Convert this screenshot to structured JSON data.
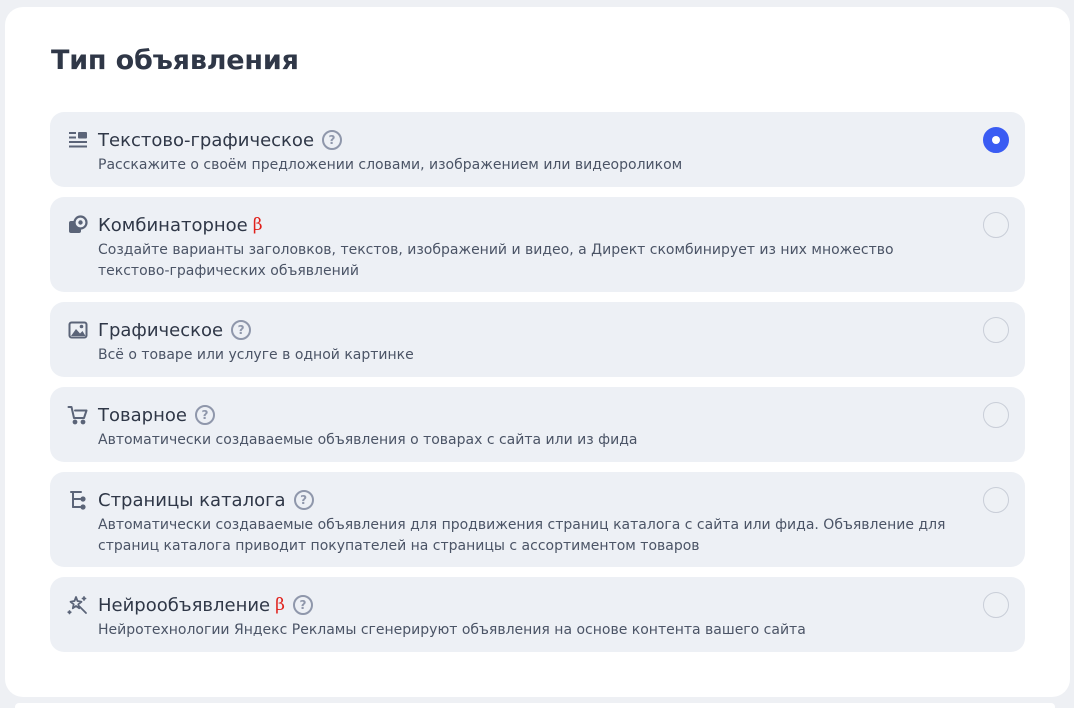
{
  "section": {
    "title": "Тип объявления"
  },
  "options": [
    {
      "id": "text-graphic",
      "name": "Текстово-графическое",
      "beta": "",
      "has_help": true,
      "description": "Расскажите о своём предложении словами, изображением или видеороликом",
      "selected": true,
      "icon": "text-graphic-icon"
    },
    {
      "id": "combinatorial",
      "name": "Комбинаторное",
      "beta": "β",
      "has_help": false,
      "description": "Создайте варианты заголовков, текстов, изображений и видео, а Директ скомбинирует из них множество текстово-графических объявлений",
      "selected": false,
      "icon": "combinatorial-icon"
    },
    {
      "id": "graphic",
      "name": "Графическое",
      "beta": "",
      "has_help": true,
      "description": "Всё о товаре или услуге в одной картинке",
      "selected": false,
      "icon": "image-icon"
    },
    {
      "id": "product",
      "name": "Товарное",
      "beta": "",
      "has_help": true,
      "description": "Автоматически создаваемые объявления о товарах с сайта или из фида",
      "selected": false,
      "icon": "cart-icon"
    },
    {
      "id": "catalog",
      "name": "Страницы каталога",
      "beta": "",
      "has_help": true,
      "description": "Автоматически создаваемые объявления для продвижения страниц каталога с сайта или фида. Объявление для страниц каталога приводит покупателей на страницы с ассортиментом товаров",
      "selected": false,
      "icon": "catalog-tree-icon"
    },
    {
      "id": "neuro",
      "name": "Нейрообъявление",
      "beta": "β",
      "has_help": true,
      "description": "Нейротехнологии Яндекс Рекламы сгенерируют объявления на основе контента вашего сайта",
      "selected": false,
      "icon": "magic-wand-icon"
    }
  ],
  "help_glyph": "?",
  "colors": {
    "accent": "#3a5cf3",
    "beta": "#e0201b",
    "option_bg": "#edf0f5"
  }
}
